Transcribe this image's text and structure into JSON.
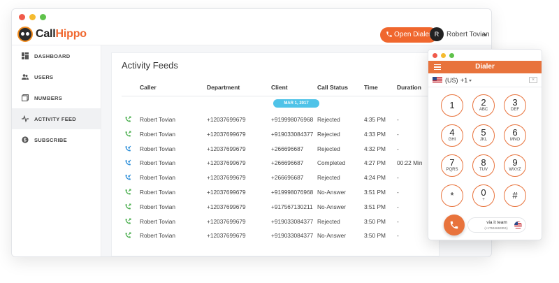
{
  "app": {
    "brand_part1": "Call",
    "brand_part2": "Hippo"
  },
  "header": {
    "open_dialer_label": "Open Dialer",
    "avatar_initial": "R",
    "user_name": "Robert Tovian"
  },
  "sidebar": {
    "items": [
      {
        "label": "DASHBOARD",
        "icon": "dashboard-icon"
      },
      {
        "label": "USERS",
        "icon": "users-icon"
      },
      {
        "label": "NUMBERS",
        "icon": "numbers-icon"
      },
      {
        "label": "ACTIVITY FEED",
        "icon": "activity-icon",
        "active": true
      },
      {
        "label": "SUBSCRIBE",
        "icon": "subscribe-icon"
      }
    ]
  },
  "feed": {
    "title": "Activity Feeds",
    "columns": {
      "caller": "Caller",
      "department": "Department",
      "client": "Client",
      "status": "Call Status",
      "time": "Time",
      "duration": "Duration"
    },
    "date_label": "MAR 1, 2017",
    "rows": [
      {
        "direction": "outgoing",
        "caller": "Robert Tovian",
        "department": "+12037699679",
        "client": "+919998076968",
        "status": "Rejected",
        "time": "4:35 PM",
        "duration": "-"
      },
      {
        "direction": "outgoing",
        "caller": "Robert Tovian",
        "department": "+12037699679",
        "client": "+919033084377",
        "status": "Rejected",
        "time": "4:33 PM",
        "duration": "-"
      },
      {
        "direction": "incoming",
        "caller": "Robert Tovian",
        "department": "+12037699679",
        "client": "+266696687",
        "status": "Rejected",
        "time": "4:32 PM",
        "duration": "-"
      },
      {
        "direction": "incoming",
        "caller": "Robert Tovian",
        "department": "+12037699679",
        "client": "+266696687",
        "status": "Completed",
        "time": "4:27 PM",
        "duration": "00:22 Min"
      },
      {
        "direction": "incoming",
        "caller": "Robert Tovian",
        "department": "+12037699679",
        "client": "+266696687",
        "status": "Rejected",
        "time": "4:24 PM",
        "duration": "-"
      },
      {
        "direction": "outgoing",
        "caller": "Robert Tovian",
        "department": "+12037699679",
        "client": "+919998076968",
        "status": "No-Answer",
        "time": "3:51 PM",
        "duration": "-"
      },
      {
        "direction": "outgoing",
        "caller": "Robert Tovian",
        "department": "+12037699679",
        "client": "+917567130211",
        "status": "No-Answer",
        "time": "3:51 PM",
        "duration": "-"
      },
      {
        "direction": "outgoing",
        "caller": "Robert Tovian",
        "department": "+12037699679",
        "client": "+919033084377",
        "status": "Rejected",
        "time": "3:50 PM",
        "duration": "-"
      },
      {
        "direction": "outgoing",
        "caller": "Robert Tovian",
        "department": "+12037699679",
        "client": "+919033084377",
        "status": "No-Answer",
        "time": "3:50 PM",
        "duration": "-"
      }
    ]
  },
  "dialer": {
    "title": "Dialer",
    "country": "(US)",
    "dial_code": "+1",
    "backspace": "×",
    "keys": [
      {
        "num": "1",
        "letters": ""
      },
      {
        "num": "2",
        "letters": "ABC"
      },
      {
        "num": "3",
        "letters": "DEF"
      },
      {
        "num": "4",
        "letters": "GHI"
      },
      {
        "num": "5",
        "letters": "JKL"
      },
      {
        "num": "6",
        "letters": "MNO"
      },
      {
        "num": "7",
        "letters": "PQRS"
      },
      {
        "num": "8",
        "letters": "TUV"
      },
      {
        "num": "9",
        "letters": "WXYZ"
      },
      {
        "num": "*",
        "letters": ""
      },
      {
        "num": "0",
        "letters": "+"
      },
      {
        "num": "#",
        "letters": ""
      }
    ],
    "via_label": "via it team",
    "via_number": "(+17534663351)"
  },
  "colors": {
    "accent": "#f0672e",
    "dialer_header": "#e8733c",
    "date_pill": "#4fc3e8",
    "incoming_icon": "#2e8fd9",
    "outgoing_icon": "#4caf50"
  }
}
